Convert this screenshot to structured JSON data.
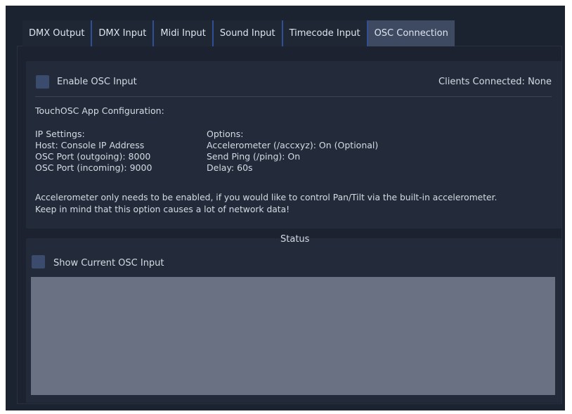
{
  "tabs": [
    {
      "label": "DMX Output",
      "active": false
    },
    {
      "label": "DMX Input",
      "active": false
    },
    {
      "label": "Midi Input",
      "active": false
    },
    {
      "label": "Sound Input",
      "active": false
    },
    {
      "label": "Timecode Input",
      "active": false
    },
    {
      "label": "OSC Connection",
      "active": true
    }
  ],
  "config": {
    "enable_label": "Enable OSC Input",
    "clients_connected": "Clients Connected: None",
    "heading": "TouchOSC App Configuration:",
    "ip_settings": {
      "title": "IP Settings:",
      "host": "Host: Console IP Address",
      "port_out": "OSC Port (outgoing): 8000",
      "port_in": "OSC Port (incoming): 9000"
    },
    "options": {
      "title": "Options:",
      "accelerometer": "Accelerometer (/accxyz): On (Optional)",
      "send_ping": "Send Ping (/ping): On",
      "delay": "Delay: 60s"
    },
    "note_line1": "Accelerometer only needs to be enabled, if you would like to control Pan/Tilt via the built-in accelerometer.",
    "note_line2": "Keep in mind that this option causes a lot of network data!"
  },
  "status": {
    "title": "Status",
    "show_label": "Show Current OSC Input",
    "output_text": ""
  },
  "colors": {
    "background": "#1b2230",
    "panel": "#232b3a",
    "tab_active": "#3d4a62",
    "tab_separator": "#2f4f96",
    "checkbox": "#3b4b6e",
    "output_area": "#6a7183"
  }
}
